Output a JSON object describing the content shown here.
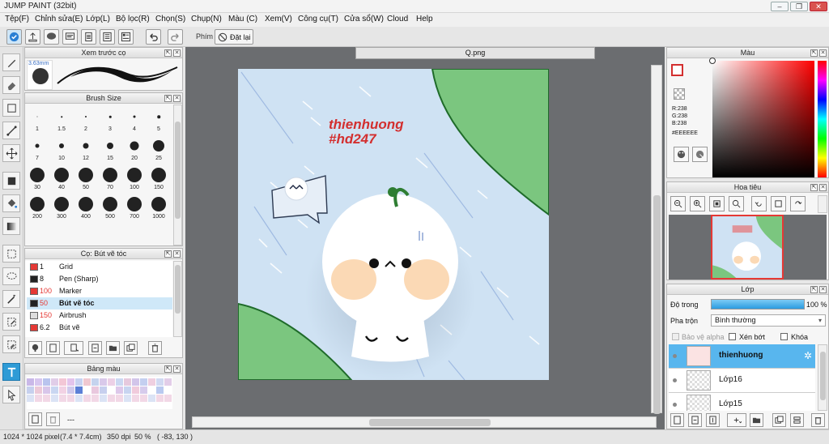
{
  "window": {
    "title": "JUMP PAINT (32bit)"
  },
  "menu": [
    "Tệp(F)",
    "Chỉnh sửa(E)",
    "Lớp(L)",
    "Bộ lọc(R)",
    "Chọn(S)",
    "Chụp(N)",
    "Màu (C)",
    "Xem(V)",
    "Công cụ(T)",
    "Cửa sổ(W)",
    "Cloud",
    "Help"
  ],
  "toolbar": {
    "keys_label": "Phím",
    "reset_label": "Đặt lại"
  },
  "brush_preview": {
    "title": "Xem trước cọ",
    "size": "3.63mm"
  },
  "brush_size": {
    "title": "Brush Size",
    "sizes": [
      "1",
      "1.5",
      "2",
      "3",
      "4",
      "5",
      "7",
      "10",
      "12",
      "15",
      "20",
      "25",
      "30",
      "40",
      "50",
      "70",
      "100",
      "150",
      "200",
      "300",
      "400",
      "500",
      "700",
      "1000"
    ]
  },
  "brush_list": {
    "title": "Cọ: Bút vẽ tóc",
    "items": [
      {
        "size": "1",
        "name": "Grid",
        "color": "#e53935",
        "size_red": false,
        "selected": false
      },
      {
        "size": "8",
        "name": "Pen (Sharp)",
        "color": "#222222",
        "size_red": false,
        "selected": false
      },
      {
        "size": "100",
        "name": "Marker",
        "color": "#e53935",
        "size_red": true,
        "selected": false
      },
      {
        "size": "50",
        "name": "Bút vẽ tóc",
        "color": "#222222",
        "size_red": true,
        "selected": true
      },
      {
        "size": "150",
        "name": "Airbrush",
        "color": "#dddddd",
        "size_red": true,
        "selected": false
      },
      {
        "size": "6.2",
        "name": "Bút vẽ",
        "color": "#e53935",
        "size_red": false,
        "selected": false
      }
    ]
  },
  "palette": {
    "title": "Bảng màu",
    "footer_text": "---"
  },
  "document": {
    "tab": "Q.png"
  },
  "artwork": {
    "line1": "thienhuong",
    "line2": "#hd247"
  },
  "color_panel": {
    "title": "Màu",
    "r": "R:238",
    "g": "G:238",
    "b": "B:238",
    "hex": "#EEEEEE"
  },
  "navigator": {
    "title": "Hoa tiêu"
  },
  "layers": {
    "title": "Lớp",
    "opacity_label": "Độ trong",
    "opacity_value": "100 %",
    "opacity_fraction": 1.0,
    "blend_label": "Pha trộn",
    "blend_value": "Bình thường",
    "protect_alpha": "Bảo vệ alpha",
    "clipping": "Xén bớt",
    "lock": "Khóa",
    "items": [
      {
        "name": "thienhuong",
        "selected": true
      },
      {
        "name": "Lớp16",
        "selected": false
      },
      {
        "name": "Lớp15",
        "selected": false
      }
    ]
  },
  "status": {
    "dims": "1024 * 1024 pixel",
    "cm": "(7.4 * 7.4cm)",
    "dpi": "350 dpi",
    "zoom": "50 %",
    "coords": "( -83, 130 )"
  },
  "colors": {
    "accent": "#58b6ee",
    "brand_red": "#e53935"
  }
}
